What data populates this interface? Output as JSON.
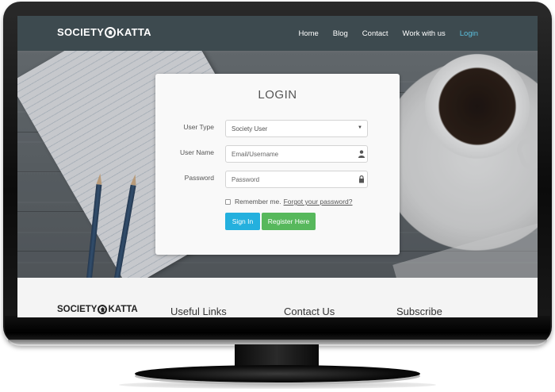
{
  "brand": {
    "left": "SOCIETY",
    "right": "KATTA"
  },
  "nav": {
    "items": [
      {
        "label": "Home"
      },
      {
        "label": "Blog"
      },
      {
        "label": "Contact"
      },
      {
        "label": "Work with us"
      },
      {
        "label": "Login",
        "active": true
      }
    ],
    "active_color": "#5bc0de"
  },
  "login": {
    "title": "LOGIN",
    "user_type_label": "User Type",
    "user_type_value": "Society User",
    "username_label": "User Name",
    "username_placeholder": "Email/Username",
    "password_label": "Password",
    "password_placeholder": "Password",
    "remember_label": "Remember me.",
    "forgot_label": "Forgot your password?",
    "signin_label": "Sign In",
    "register_label": "Register Here",
    "signin_color": "#24b0de",
    "register_color": "#57b85c"
  },
  "footer": {
    "brand_left": "SOCIETY",
    "brand_right": "KATTA",
    "useful_links": "Useful Links",
    "contact_us": "Contact Us",
    "subscribe": "Subscribe"
  },
  "icons": {
    "select_arrow": "chevron-down-icon",
    "username": "user-icon",
    "password": "lock-icon"
  }
}
